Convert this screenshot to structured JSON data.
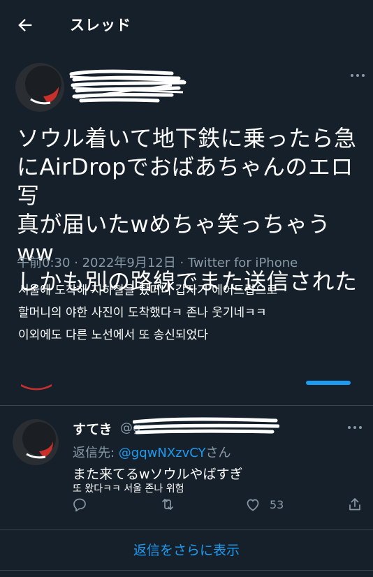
{
  "header": {
    "title": "スレッド"
  },
  "main_tweet": {
    "text_lines": [
      "ソウル着いて地下鉄に乗ったら急",
      "にAirDropでおばあちゃんのエロ写",
      "真が届いたwめちゃ笑っちゃうww",
      "しかも別の路線でまた送信された"
    ],
    "meta": "午前0:30 · 2022年9月12日 · Twitter for iPhone",
    "translation_lines": [
      "서울에 도착해 지하철을 탔더니 갑자기 에어드랍으로",
      "할머니의 야한 사진이 도착했다ㅋ 존나 웃기네ㅋㅋ",
      "이외에도 다른 노선에서 또 송신되었다"
    ]
  },
  "reply": {
    "name": "すてき",
    "handle_visible": "@g",
    "reply_to_prefix": "返信先: ",
    "reply_to_mention": "@gqwNXzvCY",
    "reply_to_suffix": "さん",
    "text": "また来てるwソウルやばすぎ",
    "translation": "또 왔다ㅋㅋ 서울 존나 위험",
    "like_count": "53"
  },
  "show_more": {
    "label": "返信をさらに表示"
  },
  "icons": {
    "back": "arrow-left-icon",
    "more": "more-horizontal-icon",
    "reply": "comment-icon",
    "retweet": "retweet-icon",
    "like": "heart-icon",
    "share": "share-icon"
  },
  "colors": {
    "background": "#15202b",
    "accent": "#1d9bf0",
    "secondary_text": "#8899a6",
    "divider": "#38444d"
  }
}
